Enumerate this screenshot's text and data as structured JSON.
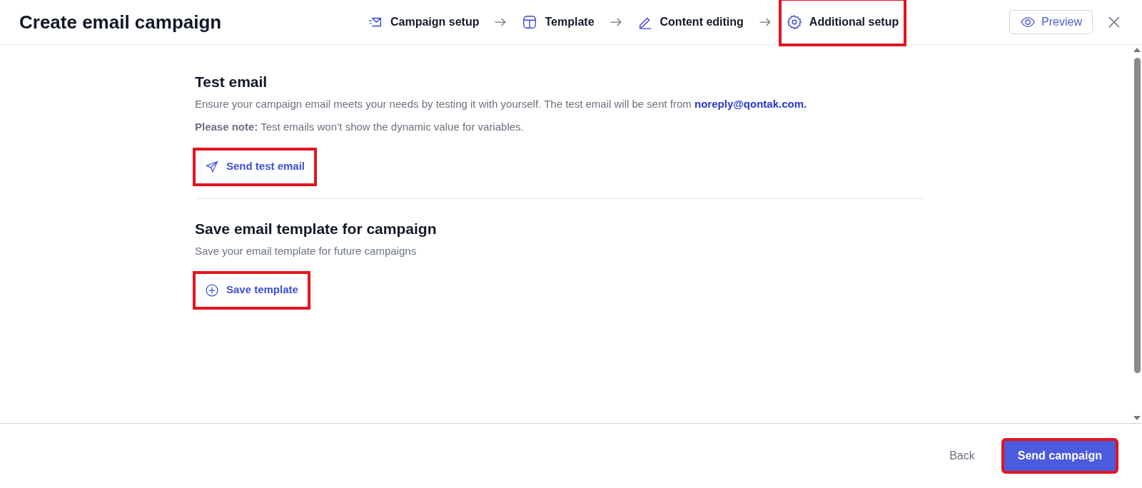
{
  "header": {
    "title": "Create email campaign",
    "steps": [
      {
        "kind": "campaign",
        "label": "Campaign setup",
        "highlighted": false
      },
      {
        "kind": "template",
        "label": "Template",
        "highlighted": false
      },
      {
        "kind": "content",
        "label": "Content editing",
        "highlighted": false
      },
      {
        "kind": "additional",
        "label": "Additional setup",
        "highlighted": true
      }
    ],
    "preview_button": "Preview"
  },
  "sections": [
    {
      "title": "Test email",
      "description": "Ensure your campaign email meets your needs by testing it with yourself. The test email will be sent from",
      "email_link": "noreply@qontak.com.",
      "note": "**Please note:** Test emails won’t show the dynamic value for variables.",
      "button": {
        "kind": "send",
        "label": "Send test email",
        "highlighted": true
      }
    },
    {
      "title": "Save email template for campaign",
      "description": "Save your email template for future campaigns",
      "button": {
        "kind": "add",
        "label": "Save template",
        "highlighted": true
      }
    }
  ],
  "footer": {
    "back_button": "Back",
    "primary_button": {
      "label": "Send campaign",
      "highlighted": true
    }
  }
}
